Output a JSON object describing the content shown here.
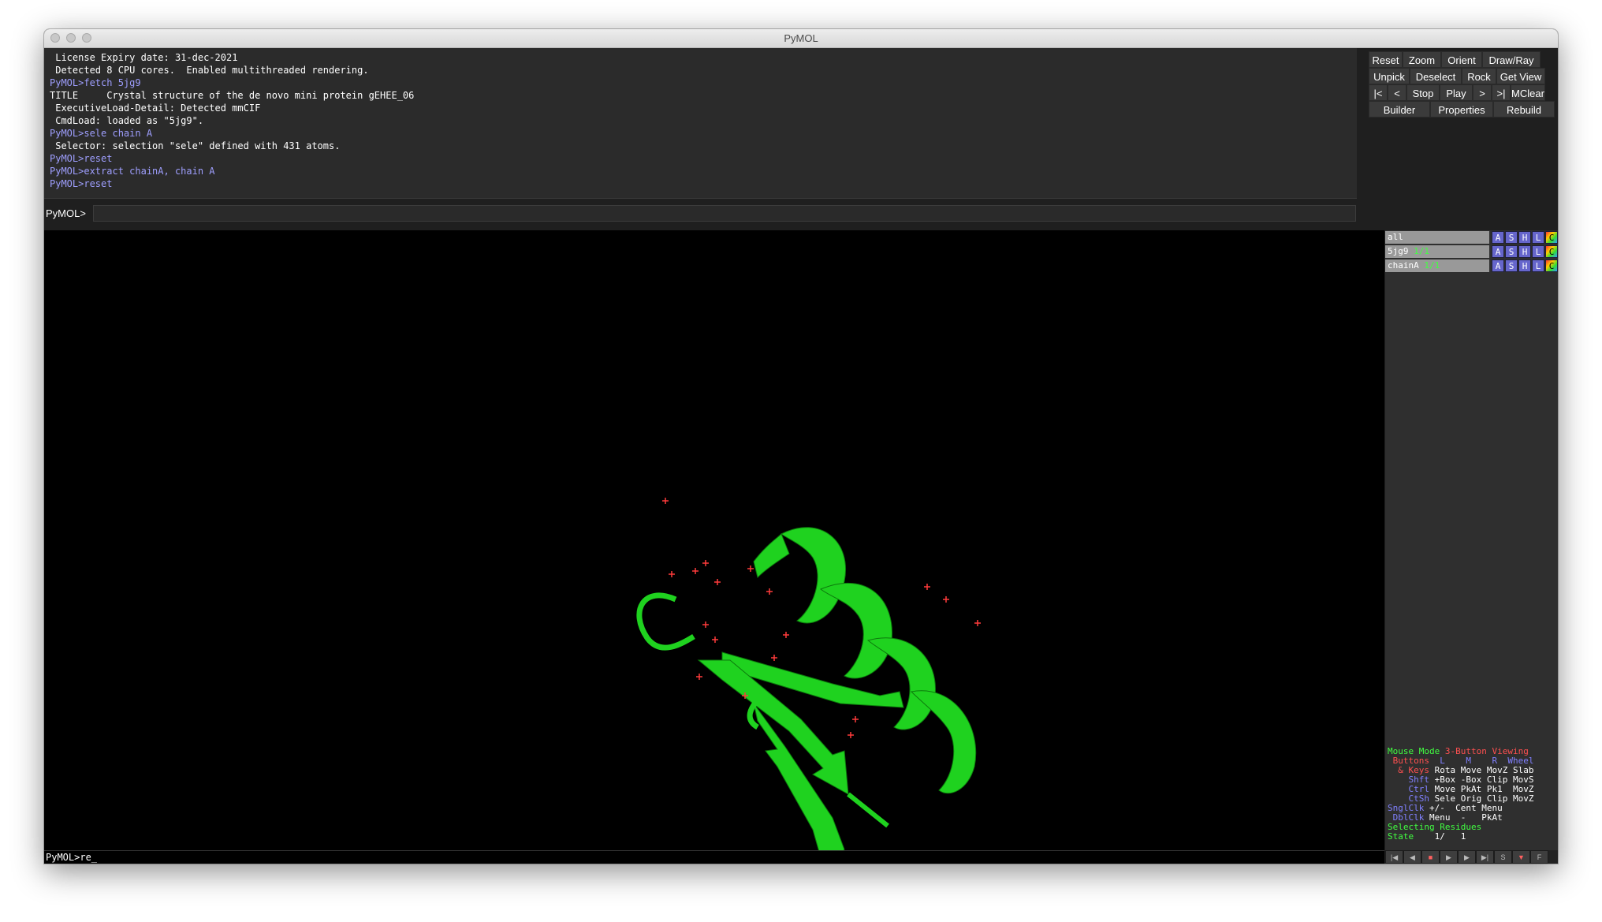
{
  "window": {
    "title": "PyMOL"
  },
  "console": {
    "lines": [
      {
        "text": " License Expiry date: 31-dec-2021",
        "kind": "out"
      },
      {
        "text": " Detected 8 CPU cores.  Enabled multithreaded rendering.",
        "kind": "out"
      },
      {
        "text": "PyMOL>fetch 5jg9",
        "kind": "cmd"
      },
      {
        "text": "TITLE     Crystal structure of the de novo mini protein gEHEE_06",
        "kind": "out"
      },
      {
        "text": " ExecutiveLoad-Detail: Detected mmCIF",
        "kind": "out"
      },
      {
        "text": " CmdLoad: loaded as \"5jg9\".",
        "kind": "out"
      },
      {
        "text": "PyMOL>sele chain A",
        "kind": "cmd"
      },
      {
        "text": " Selector: selection \"sele\" defined with 431 atoms.",
        "kind": "out"
      },
      {
        "text": "PyMOL>reset",
        "kind": "cmd"
      },
      {
        "text": "PyMOL>extract chainA, chain A",
        "kind": "cmd"
      },
      {
        "text": "PyMOL>reset",
        "kind": "cmd"
      }
    ]
  },
  "command_bar": {
    "prompt": "PyMOL>",
    "value": ""
  },
  "buttons": {
    "row1": [
      "Reset",
      "Zoom",
      "Orient",
      "Draw/Ray"
    ],
    "row2": [
      "Unpick",
      "Deselect",
      "Rock",
      "Get View"
    ],
    "row3": [
      "|<",
      "<",
      "Stop",
      "Play",
      ">",
      ">|",
      "MClear"
    ],
    "row4": [
      "Builder",
      "Properties",
      "Rebuild"
    ]
  },
  "objects": [
    {
      "name": "all",
      "state": ""
    },
    {
      "name": "5jg9",
      "state": "1/1"
    },
    {
      "name": "chainA",
      "state": "1/1"
    }
  ],
  "object_buttons": [
    "A",
    "S",
    "H",
    "L",
    "C"
  ],
  "mouse_help": {
    "mode_label": "Mouse Mode",
    "mode_value": "3-Button Viewing",
    "buttons_row": [
      "Buttons",
      "L",
      "M",
      "R",
      "Wheel"
    ],
    "rows": [
      {
        "key": "& Keys",
        "vals": "Rota Move MovZ Slab"
      },
      {
        "key": "Shft",
        "vals": "+Box -Box Clip MovS"
      },
      {
        "key": "Ctrl",
        "vals": "Move PkAt Pk1  MovZ"
      },
      {
        "key": "CtSh",
        "vals": "Sele Orig Clip MovZ"
      },
      {
        "key": "SnglClk",
        "vals": "+/-  Cent Menu"
      },
      {
        "key": "DblClk",
        "vals": "Menu  -   PkAt"
      }
    ],
    "selecting": "Selecting Residues",
    "state_label": "State",
    "state_value": "1/   1"
  },
  "status_line": "PyMOL>re_",
  "movie_controls": [
    "|◀",
    "◀",
    "■",
    "▶",
    "▶",
    "▶|",
    "S",
    "▼",
    "F"
  ],
  "colors": {
    "cartoon": "#1fd21f",
    "water": "#ff3b3b",
    "background": "#000000"
  }
}
